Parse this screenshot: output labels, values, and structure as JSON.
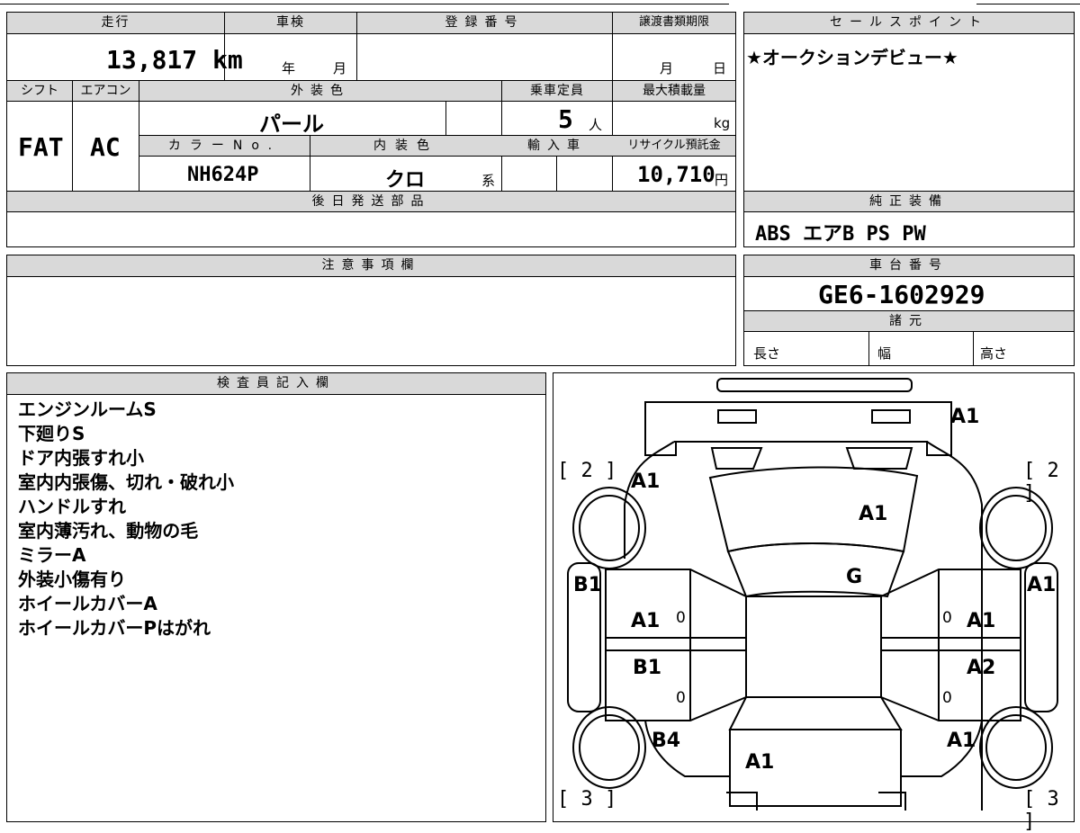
{
  "sheet": {
    "mileage_header": "走行",
    "mileage_value": "13,817 km",
    "inspection_header": "車検",
    "inspection_year_unit": "年",
    "inspection_month_unit": "月",
    "registration_header": "登録番号",
    "transfer_deadline_header": "譲渡書類期限",
    "transfer_month_unit": "月",
    "transfer_day_unit": "日",
    "sales_point_header": "セールスポイント",
    "sales_point_text": "★オークションデビュー★",
    "shift_header": "シフト",
    "shift_value": "FAT",
    "ac_header": "エアコン",
    "ac_value": "AC",
    "exterior_color_header": "外装色",
    "exterior_color_value": "パール",
    "capacity_header": "乗車定員",
    "capacity_value": "5",
    "capacity_unit": "人",
    "max_load_header": "最大積載量",
    "max_load_unit": "kg",
    "color_no_header": "カラーNo.",
    "color_no_value": "NH624P",
    "interior_color_header": "内装色",
    "interior_color_value": "クロ",
    "interior_color_suffix": "系",
    "import_header": "輸入車",
    "recycle_header": "リサイクル預託金",
    "recycle_value": "10,710",
    "recycle_unit": "円",
    "later_parts_header": "後日発送部品",
    "equipment_header": "純正装備",
    "equipment_value": "ABS エアB PS PW",
    "notes_header": "注意事項欄",
    "chassis_header": "車台番号",
    "chassis_value": "GE6-1602929",
    "spec_header": "諸元",
    "length_label": "長さ",
    "width_label": "幅",
    "height_label": "高さ",
    "inspector_header": "検査員記入欄",
    "inspector_notes": [
      "エンジンルームS",
      "下廻りS",
      "ドア内張すれ小",
      "室内内張傷、切れ・破れ小",
      "ハンドルすれ",
      "室内薄汚れ、動物の毛",
      "ミラーA",
      "外装小傷有り",
      "ホイールカバーA",
      "ホイールカバーPはがれ"
    ]
  },
  "diagram": {
    "marks": {
      "bumper_front": "A1",
      "front_left_fender": "A1",
      "hood": "A1",
      "windshield": "G",
      "front_left_pillar": "B1",
      "front_right_side": "A1",
      "front_left_door": "A1",
      "front_right_door": "A1",
      "rear_left_door": "B1",
      "rear_right_door": "A2",
      "rear_left_quarter": "B4",
      "rear_right_quarter": "A1",
      "rear_gate": "A1"
    },
    "tire_front_left": "[ 2 ]",
    "tire_front_right": "[ 2 ]",
    "tire_rear_left": "[ 3 ]",
    "tire_rear_right": "[ 3 ]",
    "door_zero": "0"
  }
}
